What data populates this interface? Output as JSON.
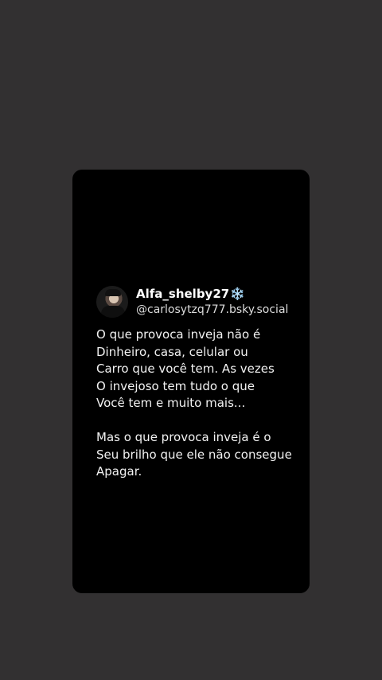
{
  "post": {
    "display_name": "Alfa_shelby27",
    "display_name_emoji": "❄️",
    "handle": "@carlosytzq777.bsky.social",
    "text": "O que provoca inveja não é\nDinheiro, casa, celular ou\nCarro que você tem. As vezes\nO invejoso tem tudo o que\nVocê tem e muito mais...\n\nMas o que provoca inveja é o\nSeu brilho que ele não consegue\nApagar."
  },
  "colors": {
    "background": "#323031",
    "card": "#000000",
    "text": "#f2f2f2"
  }
}
